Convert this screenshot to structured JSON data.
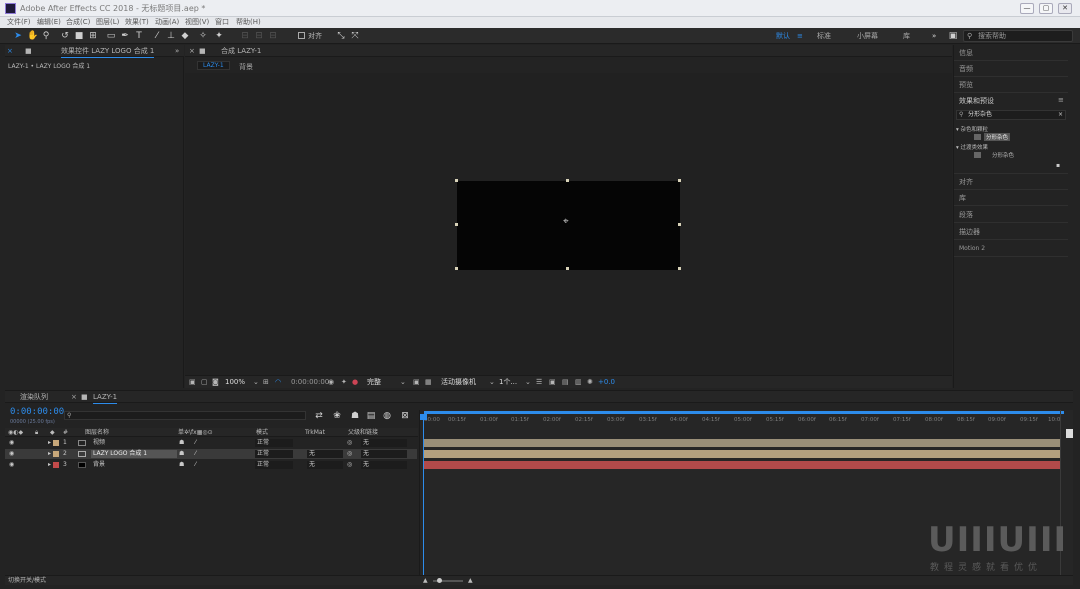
{
  "window": {
    "title": "Adobe After Effects CC 2018 - 无标题项目.aep *",
    "controls": [
      "—",
      "▢",
      "✕"
    ]
  },
  "menu": [
    "文件(F)",
    "编辑(E)",
    "合成(C)",
    "图层(L)",
    "效果(T)",
    "动画(A)",
    "视图(V)",
    "窗口",
    "帮助(H)"
  ],
  "toolbar": {
    "align_label": "对齐",
    "workspaces": [
      "默认",
      "≡",
      "标准",
      "小屏幕",
      "库"
    ],
    "more": "»",
    "search_placeholder": "搜索帮助"
  },
  "effect_controls": {
    "tab_label": "效果控件 LAZY LOGO 合成 1",
    "breadcrumb": "LAZY-1 • LAZY LOGO 合成 1"
  },
  "composition": {
    "tab_label": "合成 LAZY-1",
    "flow_tabs": [
      "LAZY-1",
      "背景"
    ],
    "footer": {
      "zoom": "100%",
      "timecode": "0:00:00:00",
      "resolution": "完整",
      "camera": "活动摄像机",
      "views": "1个...",
      "exposure": "+0.0"
    }
  },
  "right_panels": {
    "sections_top": [
      "信息",
      "音频",
      "预览"
    ],
    "effects_presets": {
      "title": "效果和预设",
      "search_value": "分形杂色",
      "tree": [
        {
          "label": "▾ 杂色和颗粒",
          "child": "分形杂色"
        },
        {
          "label": "▾ 过渡类效果",
          "child": "分形杂色"
        }
      ]
    },
    "sections_bottom": [
      "对齐",
      "库",
      "段落",
      "描边器",
      "Motion 2"
    ]
  },
  "timeline": {
    "tabs": [
      "渲染队列",
      "LAZY-1"
    ],
    "timecode": "0:00:00:00",
    "frame_info": "00000 (25.00 fps)",
    "search_placeholder": "",
    "headers": {
      "index": "#",
      "name": "图层名称",
      "switches": "单✲\\fx▦◎⊙",
      "mode": "模式",
      "trkmat": "TrkMat",
      "parent": "父级和链接"
    },
    "layers": [
      {
        "index": "1",
        "name": "视频",
        "mode": "正常",
        "trkmat": "",
        "parent": "无",
        "label_color": "#c7a77a",
        "bar_color": "#9a8f78"
      },
      {
        "index": "2",
        "name": "LAZY LOGO 合成 1",
        "mode": "正常",
        "trkmat": "无",
        "parent": "无",
        "label_color": "#c7a77a",
        "bar_color": "#b3a07f"
      },
      {
        "index": "3",
        "name": "背景",
        "mode": "正常",
        "trkmat": "无",
        "parent": "无",
        "label_color": "#c24a4a",
        "bar_color": "#b14a4a"
      }
    ],
    "ruler": [
      "00:00",
      "00:15f",
      "01:00f",
      "01:15f",
      "02:00f",
      "02:15f",
      "03:00f",
      "03:15f",
      "04:00f",
      "04:15f",
      "05:00f",
      "05:15f",
      "06:00f",
      "06:15f",
      "07:00f",
      "07:15f",
      "08:00f",
      "08:15f",
      "09:00f",
      "09:15f",
      "10:0"
    ],
    "footer_label": "切换开关/模式"
  },
  "watermark": {
    "logo": "UIIIUIII",
    "tagline": "教程灵感就看优优"
  },
  "colors": {
    "accent": "#2d8ceb",
    "panel": "#232323",
    "toolbar": "#2b2b2b",
    "canvas": "#050505"
  }
}
